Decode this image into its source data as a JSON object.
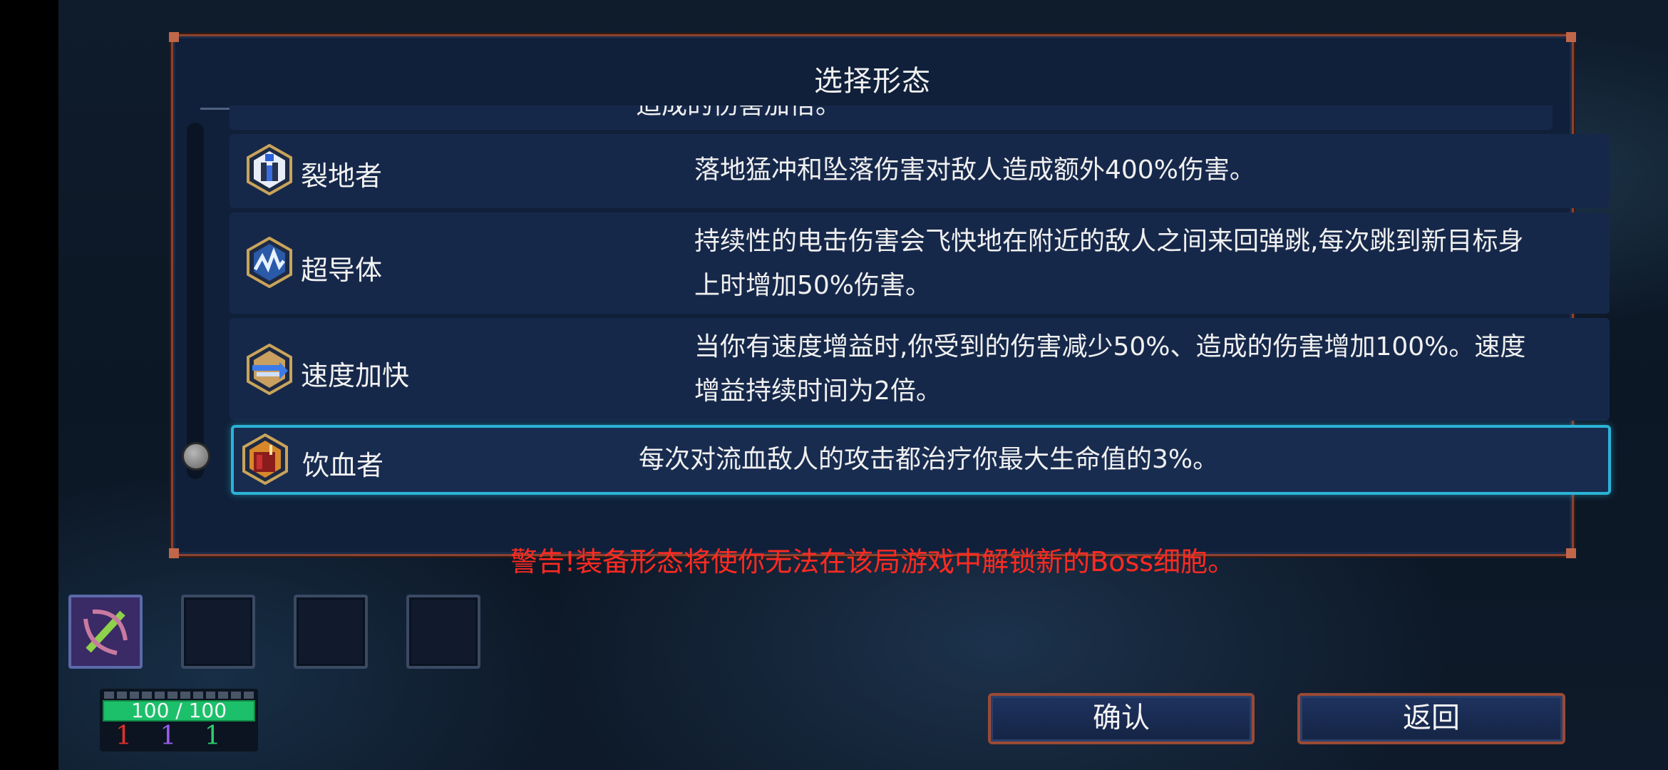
{
  "dialog": {
    "title": "选择形态",
    "partial_row_text": "造成的伤害加倍。",
    "rows": [
      {
        "icon": "ground-smash-icon",
        "name": "裂地者",
        "desc": "落地猛冲和坠落伤害对敌人造成额外400%伤害。"
      },
      {
        "icon": "lightning-icon",
        "name": "超导体",
        "desc": "持续性的电击伤害会飞快地在附近的敌人之间来回弹跳,每次跳到新目标身上时增加50%伤害。"
      },
      {
        "icon": "speed-icon",
        "name": "速度加快",
        "desc": "当你有速度增益时,你受到的伤害减少50%、造成的伤害增加100%。速度增益持续时间为2倍。"
      },
      {
        "icon": "blood-drinker-icon",
        "name": "饮血者",
        "desc": "每次对流血敌人的攻击都治疗你最大生命值的3%。"
      }
    ],
    "selected_index": 3,
    "warning": "警告!装备形态将使你无法在该局游戏中解锁新的Boss细胞。"
  },
  "player": {
    "health_text": "100 / 100",
    "health_fraction": 1.0,
    "stats": [
      {
        "value": "1",
        "color": "#e0302a"
      },
      {
        "value": "1",
        "color": "#9a5cf0"
      },
      {
        "value": "1",
        "color": "#2ecc71"
      }
    ]
  },
  "buttons": {
    "confirm": "确认",
    "back": "返回"
  },
  "colors": {
    "accent": "#2bb3d6",
    "frame": "#9a4a35",
    "warning": "#ff2a22"
  }
}
